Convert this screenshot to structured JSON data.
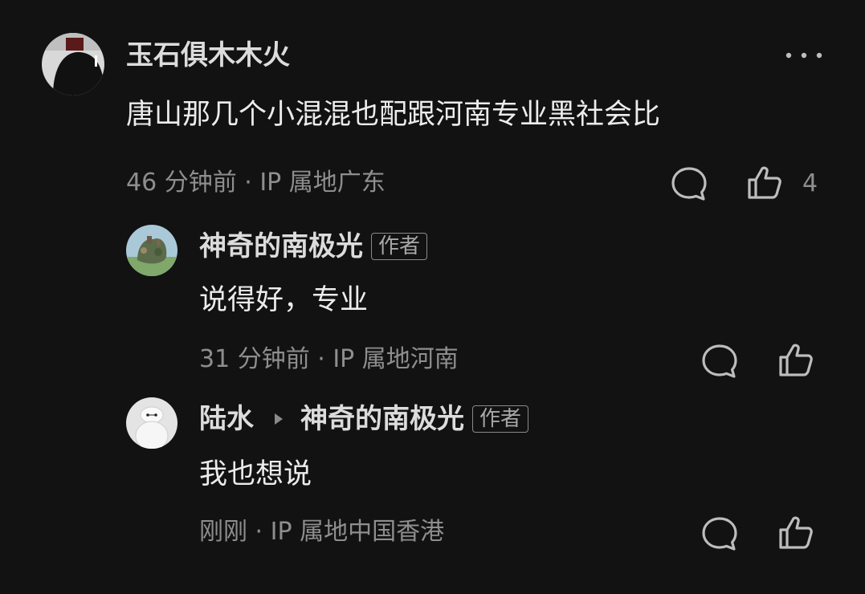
{
  "comment": {
    "username": "玉石俱木木火",
    "content": "唐山那几个小混混也配跟河南专业黑社会比",
    "meta": "46 分钟前 · IP 属地广东",
    "like_count": "4",
    "more_icon": "more-dots-icon"
  },
  "replies": [
    {
      "username": "神奇的南极光",
      "badge": "作者",
      "content": "说得好，专业",
      "meta": "31 分钟前 · IP 属地河南"
    },
    {
      "username": "陆水",
      "reply_to": "神奇的南极光",
      "badge": "作者",
      "content": "我也想说",
      "meta": "刚刚 · IP 属地中国香港"
    }
  ],
  "colors": {
    "background": "#121212",
    "text_primary": "#ececec",
    "text_secondary": "#8e8e8e"
  }
}
